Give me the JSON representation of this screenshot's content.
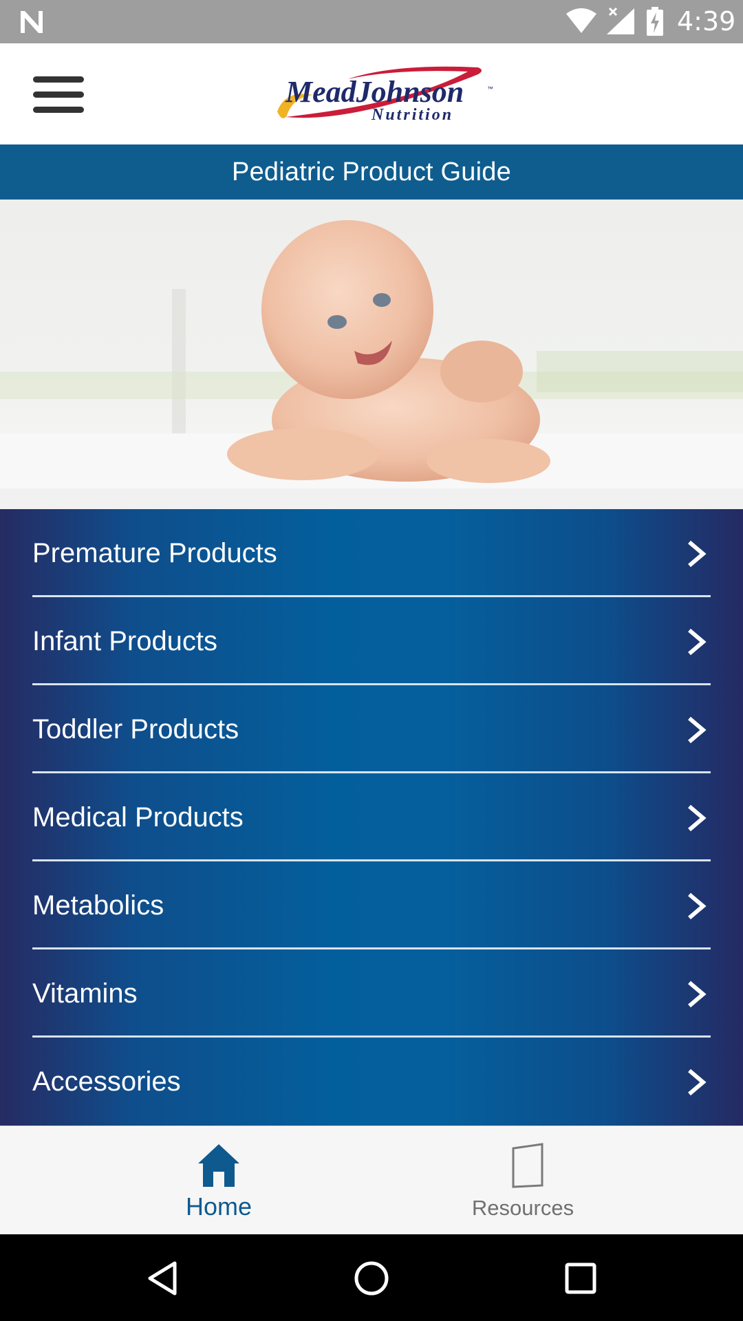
{
  "status_bar": {
    "time": "4:39",
    "icons": [
      "notification-n-icon",
      "wifi-icon",
      "cell-signal-icon",
      "battery-charging-icon"
    ]
  },
  "header": {
    "menu_icon": "hamburger-menu-icon",
    "logo": {
      "line1": "MeadJohnson",
      "line2": "Nutrition",
      "tm": "™",
      "colors": {
        "text": "#1f2a6b",
        "swoosh_red": "#c8102e",
        "swoosh_yellow": "#f0b323"
      }
    }
  },
  "title_bar": {
    "title": "Pediatric Product Guide",
    "background": "#0f5d8f"
  },
  "hero": {
    "image": "smiling-baby-photo"
  },
  "categories": [
    {
      "label": "Premature Products",
      "icon": "chevron-right-icon"
    },
    {
      "label": "Infant Products",
      "icon": "chevron-right-icon"
    },
    {
      "label": "Toddler Products",
      "icon": "chevron-right-icon"
    },
    {
      "label": "Medical Products",
      "icon": "chevron-right-icon"
    },
    {
      "label": "Metabolics",
      "icon": "chevron-right-icon"
    },
    {
      "label": "Vitamins",
      "icon": "chevron-right-icon"
    },
    {
      "label": "Accessories",
      "icon": "chevron-right-icon"
    }
  ],
  "bottom_nav": {
    "items": [
      {
        "label": "Home",
        "icon": "home-icon",
        "active": true,
        "color": "#0e5a8f"
      },
      {
        "label": "Resources",
        "icon": "book-icon",
        "active": false,
        "color": "#707070"
      }
    ]
  },
  "system_nav": {
    "buttons": [
      "back-icon",
      "home-circle-icon",
      "recents-icon"
    ]
  }
}
